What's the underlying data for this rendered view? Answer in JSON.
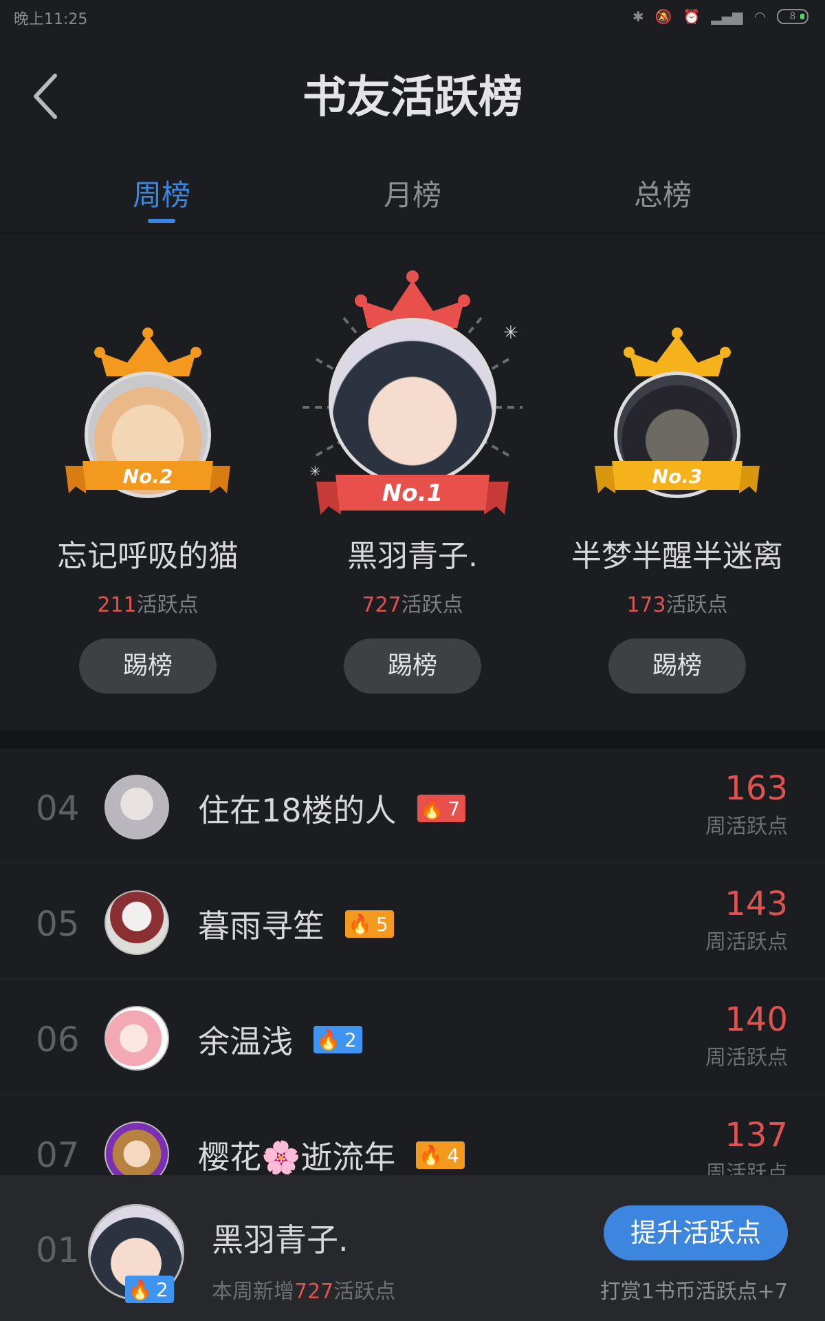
{
  "status_bar": {
    "time": "晚上11:25",
    "battery": "8"
  },
  "header": {
    "title": "书友活跃榜"
  },
  "tabs": [
    {
      "label": "周榜",
      "active": true
    },
    {
      "label": "月榜",
      "active": false
    },
    {
      "label": "总榜",
      "active": false
    }
  ],
  "podium": [
    {
      "rank_label": "No.2",
      "name": "忘记呼吸的猫",
      "points": "211",
      "points_suffix": "活跃点",
      "button": "踢榜",
      "crown_color": "#f39a1e",
      "ribbon_color": "#f39a1e"
    },
    {
      "rank_label": "No.1",
      "name": "黑羽青子.",
      "points": "727",
      "points_suffix": "活跃点",
      "button": "踢榜",
      "crown_color": "#e8504c",
      "ribbon_color": "#e8504c"
    },
    {
      "rank_label": "No.3",
      "name": "半梦半醒半迷离",
      "points": "173",
      "points_suffix": "活跃点",
      "button": "踢榜",
      "crown_color": "#f5b21b",
      "ribbon_color": "#f5b21b"
    }
  ],
  "list": [
    {
      "rank": "04",
      "name": "住在18楼的人",
      "level": "7",
      "badge_color": "red",
      "score": "163",
      "score_label": "周活跃点"
    },
    {
      "rank": "05",
      "name": "暮雨寻笙",
      "level": "5",
      "badge_color": "orange",
      "score": "143",
      "score_label": "周活跃点"
    },
    {
      "rank": "06",
      "name": "余温浅",
      "level": "2",
      "badge_color": "blue",
      "score": "140",
      "score_label": "周活跃点"
    },
    {
      "rank": "07",
      "name": "樱花🌸逝流年",
      "level": "4",
      "badge_color": "orange",
      "score": "137",
      "score_label": "周活跃点"
    }
  ],
  "me": {
    "rank": "01",
    "name": "黑羽青子.",
    "level": "2",
    "sub_prefix": "本周新增",
    "sub_points": "727",
    "sub_suffix": "活跃点",
    "button": "提升活跃点",
    "note": "打赏1书币活跃点+7"
  },
  "colors": {
    "accent": "#3d86e0",
    "score_red": "#e0524f",
    "background": "#1c1d20"
  }
}
